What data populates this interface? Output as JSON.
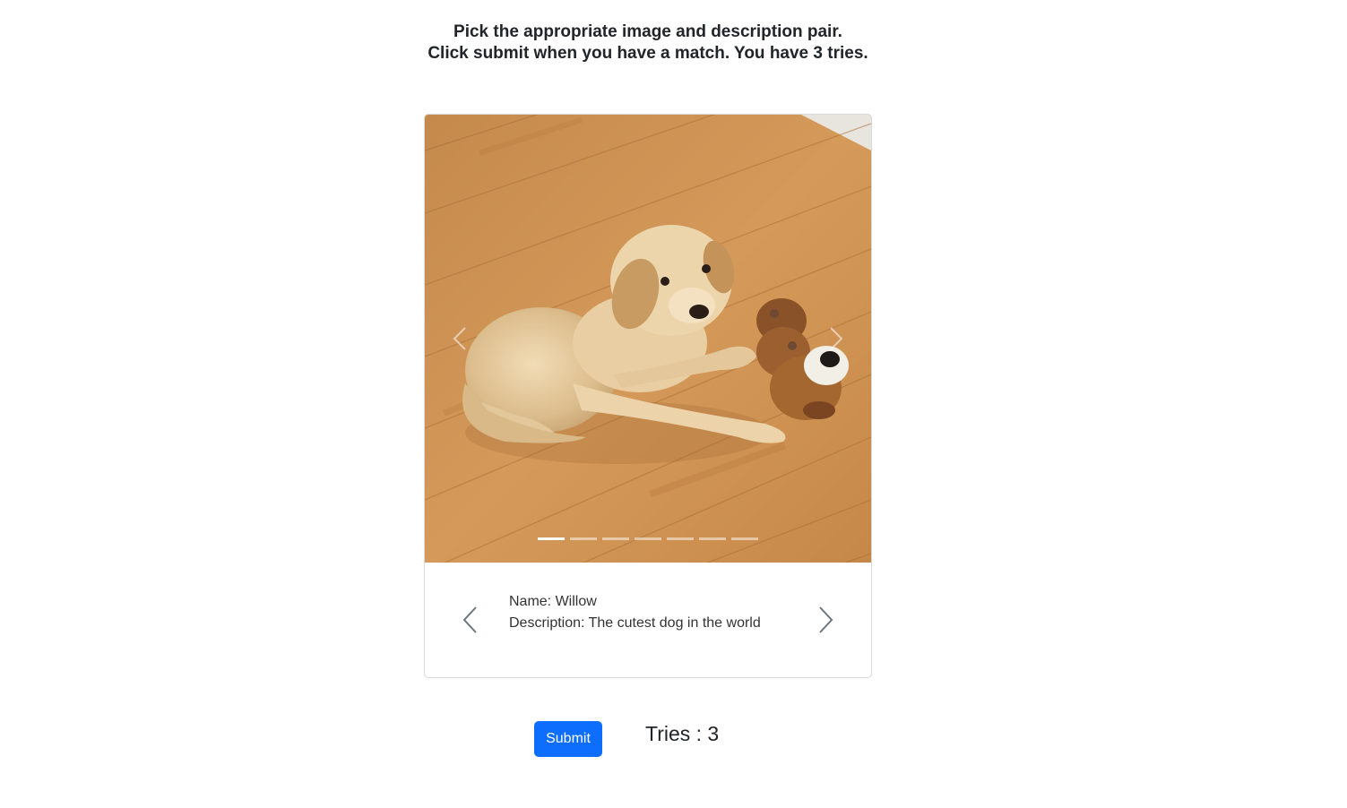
{
  "instructions": {
    "line1": "Pick the appropriate image and description pair.",
    "line2": "Click submit when you have a match. You have 3 tries."
  },
  "carousel": {
    "image_alt": "Golden retriever puppy lying on a wooden floor next to a plush toy",
    "slide_count": 7,
    "active_slide": 1,
    "prev_icon": "chevron-left-icon",
    "next_icon": "chevron-right-icon"
  },
  "description": {
    "name_line": "Name: Willow",
    "description_line": "Description: The cutest dog in the world",
    "prev_icon": "chevron-left-icon",
    "next_icon": "chevron-right-icon"
  },
  "actions": {
    "submit_label": "Submit",
    "tries_label": "Tries : 3"
  },
  "colors": {
    "primary": "#0d6efd",
    "text": "#212529"
  }
}
